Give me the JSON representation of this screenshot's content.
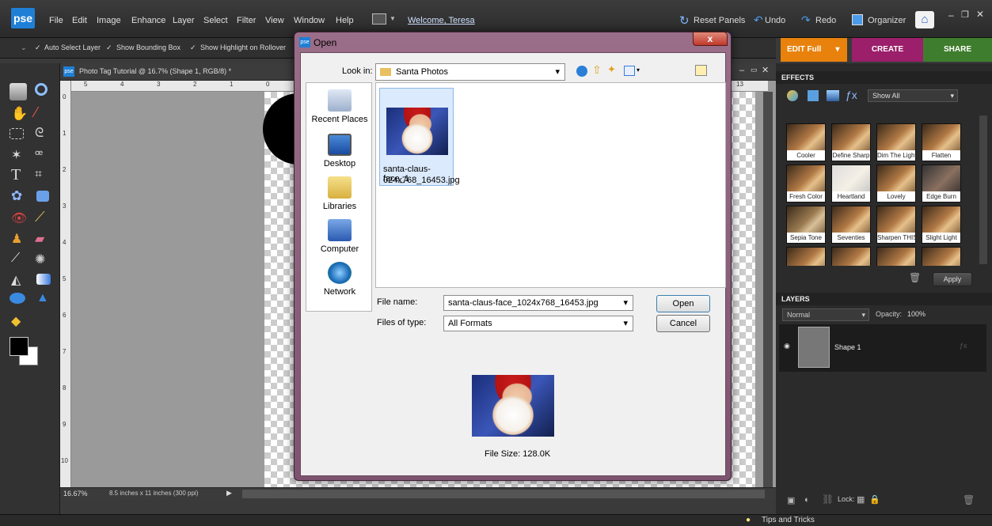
{
  "app": {
    "logo": "pse",
    "welcome": "Welcome, Teresa"
  },
  "menu": [
    "File",
    "Edit",
    "Image",
    "Enhance",
    "Layer",
    "Select",
    "Filter",
    "View",
    "Window",
    "Help"
  ],
  "topright": {
    "reset_panels": "Reset Panels",
    "undo": "Undo",
    "redo": "Redo",
    "organizer": "Organizer"
  },
  "options": {
    "auto_select": "Auto Select Layer",
    "bounding_box": "Show Bounding Box",
    "highlight": "Show Highlight on Rollover"
  },
  "mode_tabs": {
    "edit": "EDIT Full",
    "create": "CREATE",
    "share": "SHARE"
  },
  "document": {
    "title": "Photo Tag Tutorial @ 16.7% (Shape 1, RGB/8) *",
    "zoom": "16.67%",
    "size_info": "8.5 inches x 11 inches (300 ppi)",
    "h_ticks": [
      "5",
      "4",
      "3",
      "2",
      "1",
      "0",
      "13"
    ],
    "v_ticks": [
      "0",
      "1",
      "2",
      "3",
      "4",
      "5",
      "6",
      "7",
      "8",
      "9",
      "10"
    ]
  },
  "effects": {
    "header": "EFFECTS",
    "filter": "Show All",
    "apply": "Apply",
    "items": [
      "Cooler",
      "Define Sharp",
      "Dim The Lights",
      "Flatten",
      "Fresh Color",
      "Heartland",
      "Lovely",
      "Edge Burn",
      "Sepia Tone",
      "Seventies",
      "Sharpen THIS",
      "Slight Light"
    ]
  },
  "layers": {
    "header": "LAYERS",
    "blend": "Normal",
    "opacity_label": "Opacity:",
    "opacity": "100%",
    "layer_name": "Shape 1",
    "lock_label": "Lock:"
  },
  "footer": {
    "tips": "Tips and Tricks"
  },
  "dialog": {
    "title": "Open",
    "close": "x",
    "look_in_label": "Look in:",
    "look_in_value": "Santa Photos",
    "places": [
      "Recent Places",
      "Desktop",
      "Libraries",
      "Computer",
      "Network"
    ],
    "file": {
      "name_line1": "santa-claus-face_1",
      "name_line2": "024x768_16453.jpg"
    },
    "file_name_label": "File name:",
    "file_name_value": "santa-claus-face_1024x768_16453.jpg",
    "files_of_type_label": "Files of type:",
    "files_of_type_value": "All Formats",
    "open_button": "Open",
    "cancel_button": "Cancel",
    "file_size": "File Size: 128.0K"
  }
}
